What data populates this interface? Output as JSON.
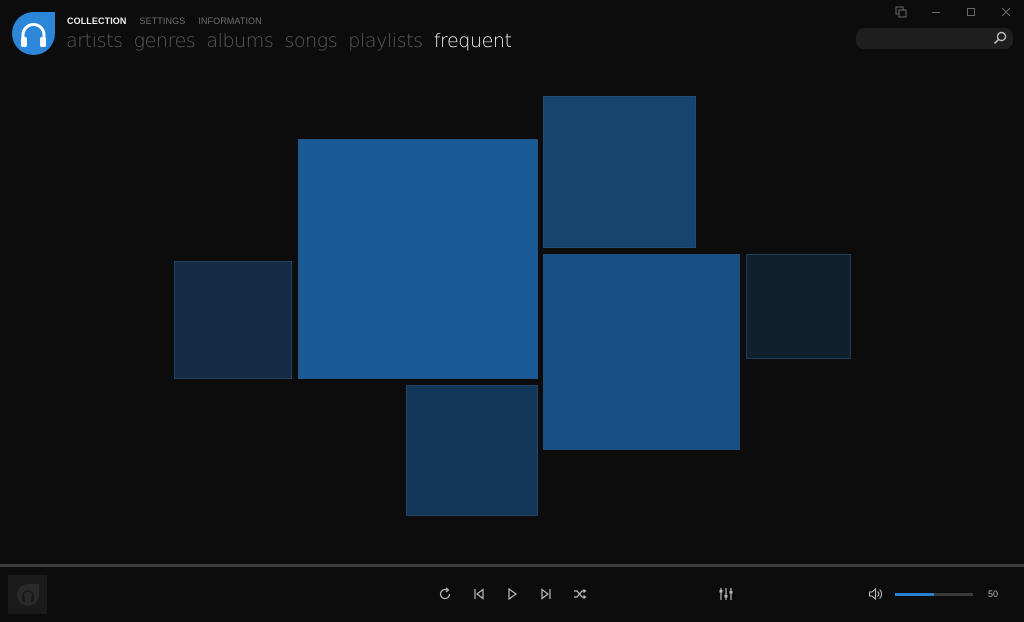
{
  "app": {
    "logo_icon": "headphones-drop-icon",
    "brand_color": "#2c86d9"
  },
  "subnav": {
    "items": [
      {
        "label": "COLLECTION",
        "active": true
      },
      {
        "label": "SETTINGS",
        "active": false
      },
      {
        "label": "INFORMATION",
        "active": false
      }
    ]
  },
  "mainnav": {
    "items": [
      {
        "label": "artists",
        "active": false
      },
      {
        "label": "genres",
        "active": false
      },
      {
        "label": "albums",
        "active": false
      },
      {
        "label": "songs",
        "active": false
      },
      {
        "label": "playlists",
        "active": false
      },
      {
        "label": "frequent",
        "active": true
      }
    ]
  },
  "window_controls": {
    "icons": [
      "cover-mode-icon",
      "minimize-icon",
      "maximize-icon",
      "close-icon"
    ]
  },
  "search": {
    "value": "",
    "placeholder": "",
    "icon": "search-icon"
  },
  "frequent_tiles": [
    {
      "name": "tile-1",
      "color": "#132b45"
    },
    {
      "name": "tile-2",
      "color": "#1a5a96"
    },
    {
      "name": "tile-3",
      "color": "#15446f"
    },
    {
      "name": "tile-4",
      "color": "#174f85"
    },
    {
      "name": "tile-5",
      "color": "#11202f"
    },
    {
      "name": "tile-6",
      "color": "#143658"
    }
  ],
  "player": {
    "progress_fraction": 0,
    "controls": [
      "loop-icon",
      "previous-icon",
      "play-icon",
      "next-icon",
      "shuffle-icon"
    ],
    "equalizer_icon": "equalizer-icon",
    "volume_icon": "speaker-icon",
    "volume": 50,
    "volume_label": "50",
    "volume_color": "#2a7fd4"
  }
}
